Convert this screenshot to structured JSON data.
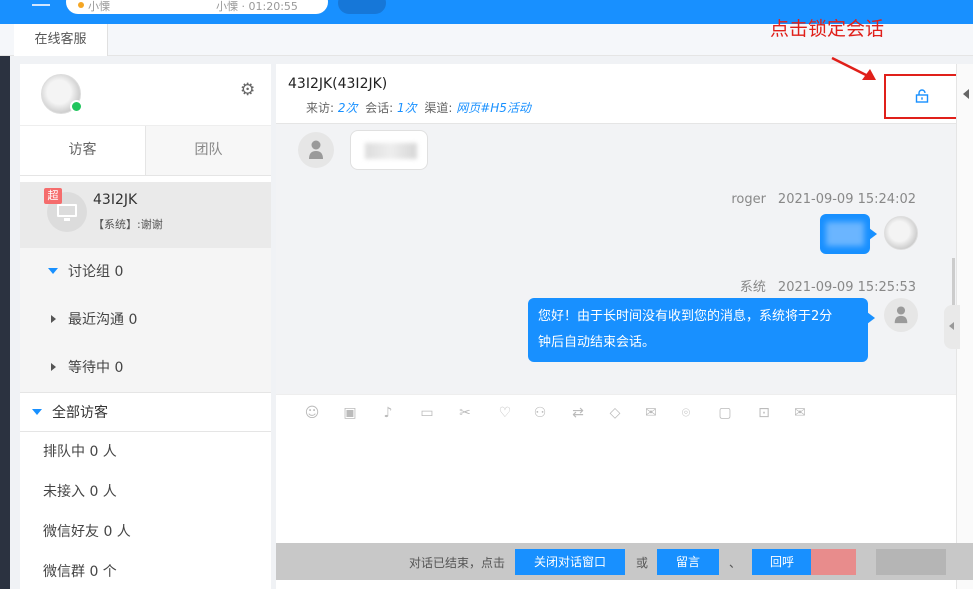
{
  "topbar": {
    "field1": "小慄",
    "field2": "小慄 · 01:20:55"
  },
  "tabs": {
    "online_service": "在线客服"
  },
  "sidebar": {
    "tabs": [
      "访客",
      "团队"
    ],
    "visitor": {
      "badge": "超",
      "name": "43I2JK",
      "last_msg": "【系统】:谢谢"
    },
    "groups": [
      {
        "label": "讨论组 0",
        "expanded": true
      },
      {
        "label": "最近沟通 0",
        "expanded": false
      },
      {
        "label": "等待中 0",
        "expanded": false
      }
    ],
    "all_visitors": "全部访客",
    "stats": [
      "排队中 0 人",
      "未接入 0 人",
      "微信好友 0 人",
      "微信群 0 个"
    ]
  },
  "chat": {
    "title": "43I2JK(43I2JK)",
    "meta": {
      "visits_label": "来访:",
      "visits_value": "2次",
      "sessions_label": "会话:",
      "sessions_value": "1次",
      "channel_label": "渠道:",
      "channel_value": "网页#H5活动"
    },
    "messages": [
      {
        "sender": "roger",
        "time": "2021-09-09 15:24:02"
      },
      {
        "sender": "系统",
        "time": "2021-09-09 15:25:53",
        "text_line1": "您好！由于长时间没有收到您的消息，系统将于2分",
        "text_line2": "钟后自动结束会话。"
      }
    ],
    "tool_icons": [
      "emoji-icon",
      "image-icon",
      "mic-icon",
      "folder-icon",
      "scissors-icon",
      "heart-icon",
      "user-transfer-icon",
      "swap-icon",
      "tag-icon",
      "mail-icon",
      "location-icon",
      "video-icon",
      "screen-icon",
      "envelope-icon"
    ]
  },
  "endbar": {
    "ended_text": "对话已结束，点击",
    "close_btn": "关闭对话窗口",
    "or": "或",
    "leave_msg_btn": "留言",
    "sep": "、",
    "callback_btn": "回呼"
  },
  "annotation": {
    "text": "点击锁定会话",
    "color": "#e0201a"
  },
  "colors": {
    "primary": "#1890ff",
    "online": "#21c55d",
    "vip": "#f56c6c"
  }
}
